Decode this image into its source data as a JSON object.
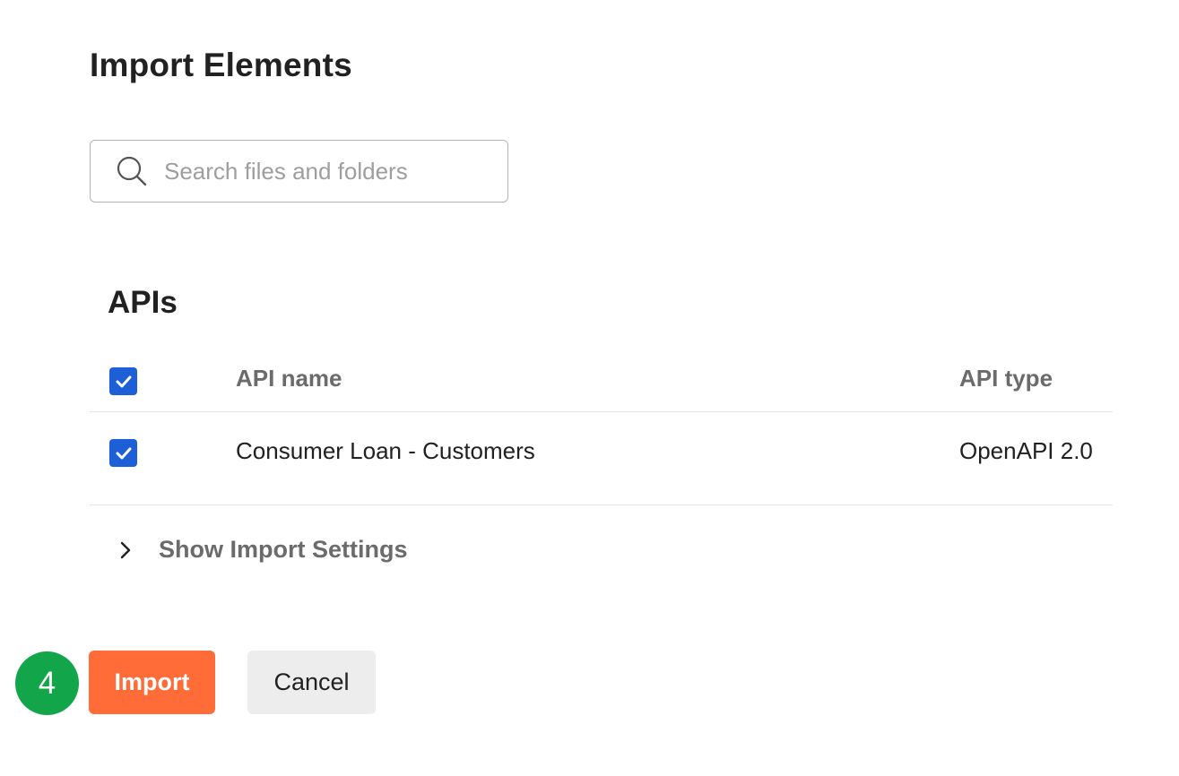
{
  "dialog": {
    "title": "Import Elements"
  },
  "search": {
    "placeholder": "Search files and folders",
    "value": ""
  },
  "apis_section": {
    "title": "APIs",
    "columns": {
      "name": "API name",
      "type": "API type"
    },
    "select_all_checked": true,
    "rows": [
      {
        "name": "Consumer Loan - Customers",
        "type": "OpenAPI 2.0",
        "checked": true
      }
    ]
  },
  "settings_toggle": {
    "label": "Show Import Settings"
  },
  "step_badge": {
    "number": "4"
  },
  "actions": {
    "import_label": "Import",
    "cancel_label": "Cancel"
  },
  "colors": {
    "primary": "#ff6c37",
    "checkbox": "#1c5fd6",
    "step_badge": "#12a54a"
  },
  "icons": {
    "search": "search-icon",
    "checkbox": "checkmark-icon",
    "expand": "chevron-right-icon"
  }
}
